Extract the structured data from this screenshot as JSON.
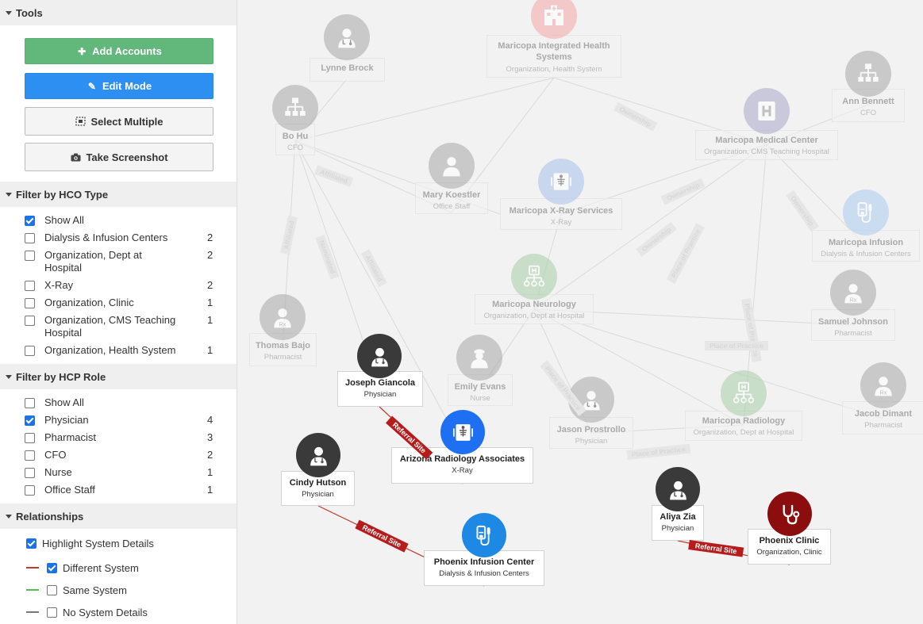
{
  "tools": {
    "header": "Tools",
    "add_accounts": "Add Accounts",
    "edit_mode": "Edit Mode",
    "select_multiple": "Select Multiple",
    "take_screenshot": "Take Screenshot",
    "add_color": "#62b77b",
    "edit_color": "#2d8ff2"
  },
  "hco_filter": {
    "header": "Filter by HCO Type",
    "items": [
      {
        "label": "Show All",
        "checked": true,
        "count": ""
      },
      {
        "label": "Dialysis & Infusion Centers",
        "checked": false,
        "count": "2"
      },
      {
        "label": "Organization, Dept at Hospital",
        "checked": false,
        "count": "2"
      },
      {
        "label": "X-Ray",
        "checked": false,
        "count": "2"
      },
      {
        "label": "Organization, Clinic",
        "checked": false,
        "count": "1"
      },
      {
        "label": "Organization, CMS Teaching Hospital",
        "checked": false,
        "count": "1"
      },
      {
        "label": "Organization, Health System",
        "checked": false,
        "count": "1"
      }
    ]
  },
  "hcp_filter": {
    "header": "Filter by HCP Role",
    "items": [
      {
        "label": "Show All",
        "checked": false,
        "count": ""
      },
      {
        "label": "Physician",
        "checked": true,
        "count": "4"
      },
      {
        "label": "Pharmacist",
        "checked": false,
        "count": "3"
      },
      {
        "label": "CFO",
        "checked": false,
        "count": "2"
      },
      {
        "label": "Nurse",
        "checked": false,
        "count": "1"
      },
      {
        "label": "Office Staff",
        "checked": false,
        "count": "1"
      }
    ]
  },
  "relationships": {
    "header": "Relationships",
    "highlight": {
      "label": "Highlight System Details",
      "checked": true
    },
    "items": [
      {
        "label": "Different System",
        "checked": true,
        "line_color": "#c0392b"
      },
      {
        "label": "Same System",
        "checked": false,
        "line_color": "#5cb85c"
      },
      {
        "label": "No System Details",
        "checked": false,
        "line_color": "#777777"
      }
    ]
  },
  "graph": {
    "nodes": {
      "maricopa_health": {
        "name": "Maricopa Integrated Health Systems",
        "sub": "Organization, Health System",
        "icon": "hospital-building-icon",
        "color": "#f2a7a7"
      },
      "lynne": {
        "name": "Lynne Brock",
        "sub": "",
        "icon": "physician-icon",
        "color": "#a8a8a8"
      },
      "bo_hu": {
        "name": "Bo Hu",
        "sub": "CFO",
        "icon": "org-chart-icon",
        "color": "#a8a8a8"
      },
      "ann": {
        "name": "Ann Bennett",
        "sub": "CFO",
        "icon": "org-chart-icon",
        "color": "#a8a8a8"
      },
      "maricopa_medical": {
        "name": "Maricopa Medical Center",
        "sub": "Organization, CMS Teaching Hospital",
        "icon": "hospital-h-icon",
        "color": "#a9a9c9"
      },
      "mary": {
        "name": "Mary Koestler",
        "sub": "Office Staff",
        "icon": "person-icon",
        "color": "#a8a8a8"
      },
      "xray_services": {
        "name": "Maricopa X-Ray Services",
        "sub": "X-Ray",
        "icon": "xray-icon",
        "color": "#a9c1ec"
      },
      "infusion_maricopa": {
        "name": "Maricopa Infusion",
        "sub": "Dialysis & Infusion Centers",
        "icon": "infusion-icon",
        "color": "#a9cbf0"
      },
      "neurology": {
        "name": "Maricopa Neurology",
        "sub": "Organization, Dept at Hospital",
        "icon": "dept-hospital-icon",
        "color": "#a9cfa9"
      },
      "samuel": {
        "name": "Samuel Johnson",
        "sub": "Pharmacist",
        "icon": "pharmacist-icon",
        "color": "#a8a8a8"
      },
      "thomas": {
        "name": "Thomas Bajo",
        "sub": "Pharmacist",
        "icon": "pharmacist-icon",
        "color": "#a8a8a8"
      },
      "emily": {
        "name": "Emily Evans",
        "sub": "Nurse",
        "icon": "nurse-icon",
        "color": "#a8a8a8"
      },
      "jason": {
        "name": "Jason Prostrollo",
        "sub": "Physician",
        "icon": "physician-icon",
        "color": "#a8a8a8"
      },
      "radiology": {
        "name": "Maricopa Radiology",
        "sub": "Organization, Dept at Hospital",
        "icon": "dept-hospital-icon",
        "color": "#a9cfa9"
      },
      "jacob": {
        "name": "Jacob Dimant",
        "sub": "Pharmacist",
        "icon": "pharmacist-icon",
        "color": "#a8a8a8"
      },
      "joseph": {
        "name": "Joseph Giancola",
        "sub": "Physician",
        "icon": "physician-icon",
        "color": "#3a3a3a"
      },
      "arizona": {
        "name": "Arizona Radiology Associates",
        "sub": "X-Ray",
        "icon": "xray-icon",
        "color": "#1e6ff2"
      },
      "cindy": {
        "name": "Cindy Hutson",
        "sub": "Physician",
        "icon": "physician-icon",
        "color": "#3a3a3a"
      },
      "phoenix_infusion": {
        "name": "Phoenix Infusion Center",
        "sub": "Dialysis & Infusion Centers",
        "icon": "infusion-icon",
        "color": "#1e88e5"
      },
      "aliya": {
        "name": "Aliya Zia",
        "sub": "Physician",
        "icon": "physician-icon",
        "color": "#3a3a3a"
      },
      "phoenix_clinic": {
        "name": "Phoenix Clinic",
        "sub": "Organization, Clinic",
        "icon": "stethoscope-icon",
        "color": "#8b0d0d"
      }
    },
    "edge_labels": {
      "referral": "Referral Site",
      "affiliated": "Affiliated",
      "ownership": "Ownership",
      "nominated": "Nominated",
      "place_of_practice": "Place of Practice"
    },
    "referral_color": "#b71c1c"
  }
}
